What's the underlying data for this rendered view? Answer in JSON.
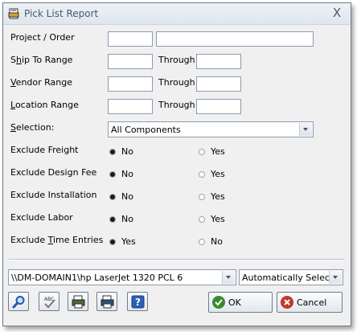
{
  "window": {
    "title": "Pick List Report",
    "close_glyph": "X"
  },
  "labels": {
    "project_order": "Project / Order",
    "ship_prefix": "S",
    "ship_u": "h",
    "ship_rest": "ip To Range",
    "vendor_u": "V",
    "vendor_rest": "endor Range",
    "location_u": "L",
    "location_rest": "ocation Range",
    "selection_u": "S",
    "selection_rest": "election:",
    "through": "Through"
  },
  "fields": {
    "project_order": "",
    "project_order_desc": "",
    "ship_from": "",
    "ship_to": "",
    "vendor_from": "",
    "vendor_to": "",
    "location_from": "",
    "location_to": ""
  },
  "selection": {
    "value": "All Components"
  },
  "options": [
    {
      "label": "Exclude Freight",
      "no": "No",
      "yes": "Yes",
      "selected": "no"
    },
    {
      "label": "Exclude Design Fee",
      "no": "No",
      "yes": "Yes",
      "selected": "no"
    },
    {
      "label": "Exclude Installation",
      "no": "No",
      "yes": "Yes",
      "selected": "no"
    },
    {
      "label": "Exclude Labor",
      "no": "No",
      "yes": "Yes",
      "selected": "no"
    },
    {
      "label_prefix": "Exclude ",
      "label_u": "T",
      "label_rest": "ime Entries",
      "first": "Yes",
      "second": "No",
      "selected": "first"
    }
  ],
  "printer": {
    "value": "\\\\DM-DOMAIN1\\hp LaserJet 1320 PCL 6"
  },
  "tray": {
    "value": "Automatically Select"
  },
  "buttons": {
    "ok": "OK",
    "cancel": "Cancel"
  },
  "icons": [
    "report-icon",
    "search-icon",
    "spellcheck-icon",
    "print-preview-icon",
    "printer-icon",
    "help-icon",
    "check-icon",
    "cancel-icon"
  ],
  "colors": {
    "ok_green": "#3b8a2f",
    "cancel_red": "#c0392b",
    "border": "#8a9bb2"
  }
}
